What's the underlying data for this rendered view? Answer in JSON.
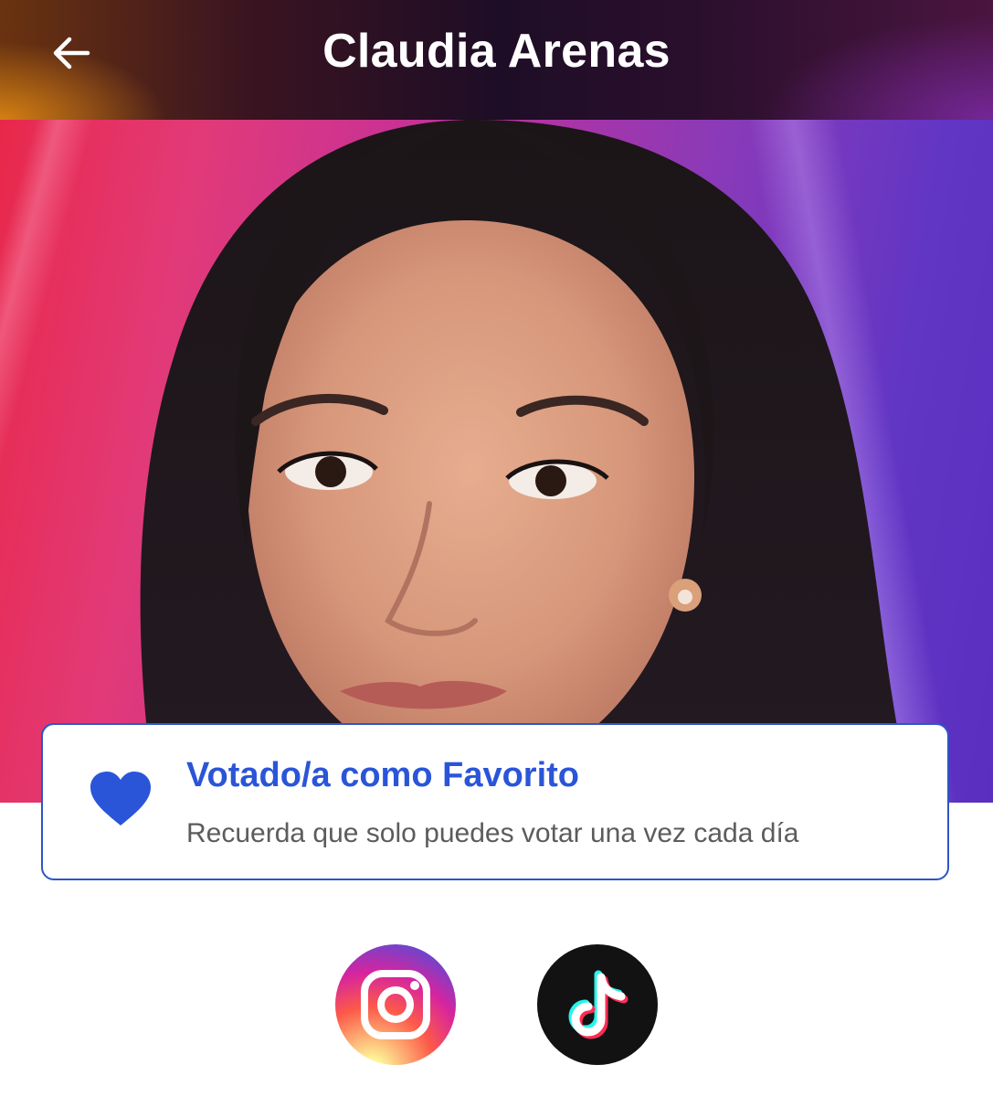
{
  "header": {
    "title": "Claudia Arenas",
    "back_icon": "arrow-left-icon"
  },
  "vote_card": {
    "icon": "heart-icon",
    "title": "Votado/a como Favorito",
    "subtitle": "Recuerda que solo puedes votar una vez cada día",
    "accent_color": "#2a55d8"
  },
  "social": {
    "items": [
      {
        "name": "Instagram",
        "icon": "instagram-icon"
      },
      {
        "name": "TikTok",
        "icon": "tiktok-icon"
      }
    ]
  },
  "colors": {
    "accent": "#2a55d8",
    "subtitle_text": "#5c5c5c",
    "header_text": "#ffffff"
  }
}
